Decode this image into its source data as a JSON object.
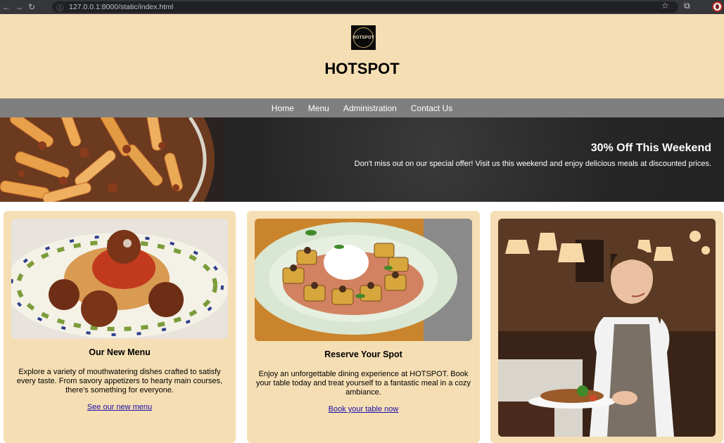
{
  "browser": {
    "url": "127.0.0.1:8000/static/index.html"
  },
  "header": {
    "logo_text": "HOTSPOT",
    "title": "HOTSPOT"
  },
  "nav": {
    "items": [
      "Home",
      "Menu",
      "Administration",
      "Contact Us"
    ]
  },
  "hero": {
    "title": "30% Off This Weekend",
    "text": "Don't miss out on our special offer! Visit us this weekend and enjoy delicious meals at discounted prices."
  },
  "cards": [
    {
      "title": "Our New Menu",
      "text": "Explore a variety of mouthwatering dishes crafted to satisfy every taste. From savory appetizers to hearty main courses, there's something for everyone.",
      "link": "See our new menu"
    },
    {
      "title": "Reserve Your Spot",
      "text": "Enjoy an unforgettable dining experience at HOTSPOT. Book your table today and treat yourself to a fantastic meal in a cozy ambiance.",
      "link": "Book your table now"
    }
  ],
  "colors": {
    "background_beige": "#f5deb3",
    "nav_gray": "#7f7f7f",
    "hero_dark": "#262626",
    "link_blue": "#1a0dab"
  }
}
